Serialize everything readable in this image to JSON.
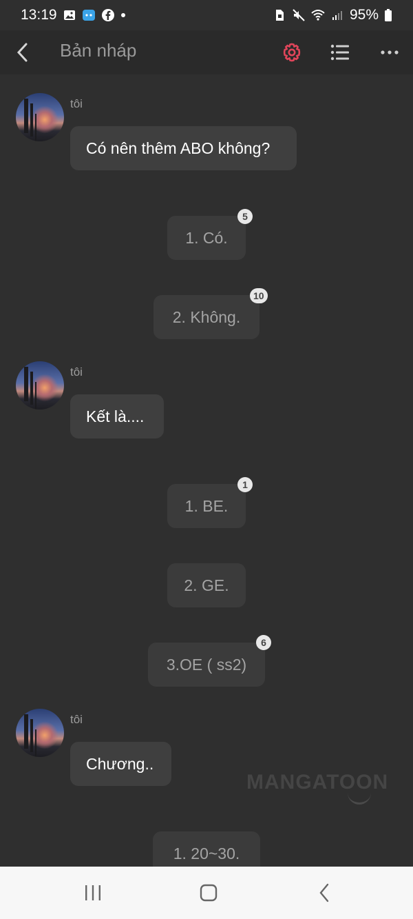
{
  "status_bar": {
    "time": "13:19",
    "battery": "95%",
    "left_icons": [
      "gallery-icon",
      "messenger-bot-icon",
      "facebook-icon",
      "dot-icon"
    ],
    "right_icons": [
      "sim-icon",
      "mute-icon",
      "wifi-icon",
      "signal-icon",
      "battery-icon"
    ]
  },
  "header": {
    "title": "Bản nháp",
    "accent_color": "#e0455a"
  },
  "messages": [
    {
      "sender": "tôi",
      "text": "Có nên thêm ABO không?"
    },
    {
      "sender": "tôi",
      "text": "Kết là...."
    },
    {
      "sender": "tôi",
      "text": "Chương.."
    }
  ],
  "option_groups": [
    {
      "options": [
        {
          "label": "1. Có.",
          "count": "5"
        },
        {
          "label": "2. Không.",
          "count": "10"
        }
      ]
    },
    {
      "options": [
        {
          "label": "1. BE.",
          "count": "1"
        },
        {
          "label": "2. GE.",
          "count": ""
        },
        {
          "label": "3.OE ( ss2)",
          "count": "6"
        }
      ]
    },
    {
      "options": [
        {
          "label": "1. 20~30.",
          "count": ""
        }
      ]
    }
  ],
  "watermark": "MANGATOON",
  "nav": [
    "recent-apps-icon",
    "home-icon",
    "back-icon"
  ]
}
